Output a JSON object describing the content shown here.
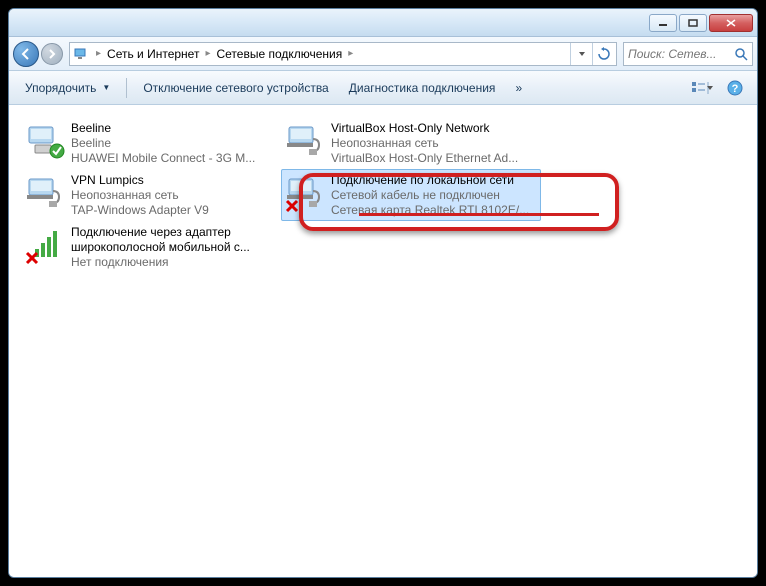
{
  "breadcrumb": {
    "item1": "Сеть и Интернет",
    "item2": "Сетевые подключения"
  },
  "search": {
    "placeholder": "Поиск: Сетев..."
  },
  "toolbar": {
    "organize": "Упорядочить",
    "disable": "Отключение сетевого устройства",
    "diagnose": "Диагностика подключения",
    "more": "»"
  },
  "connections": [
    {
      "name": "Beeline",
      "status": "Beeline",
      "device": "HUAWEI Mobile Connect - 3G M...",
      "icon": "wan-ok"
    },
    {
      "name": "VirtualBox Host-Only Network",
      "status": "Неопознанная сеть",
      "device": "VirtualBox Host-Only Ethernet Ad...",
      "icon": "lan"
    },
    {
      "name": "VPN Lumpics",
      "status": "Неопознанная сеть",
      "device": "TAP-Windows Adapter V9",
      "icon": "lan"
    },
    {
      "name": "Подключение по локальной сети",
      "status": "Сетевой кабель не подключен",
      "device": "Сетевая карта Realtek RTL8102E/...",
      "icon": "lan-x",
      "selected": true
    },
    {
      "name": "Подключение через адаптер широкополосной мобильной с...",
      "status": "Нет подключения",
      "device": "",
      "icon": "signal-x"
    }
  ]
}
